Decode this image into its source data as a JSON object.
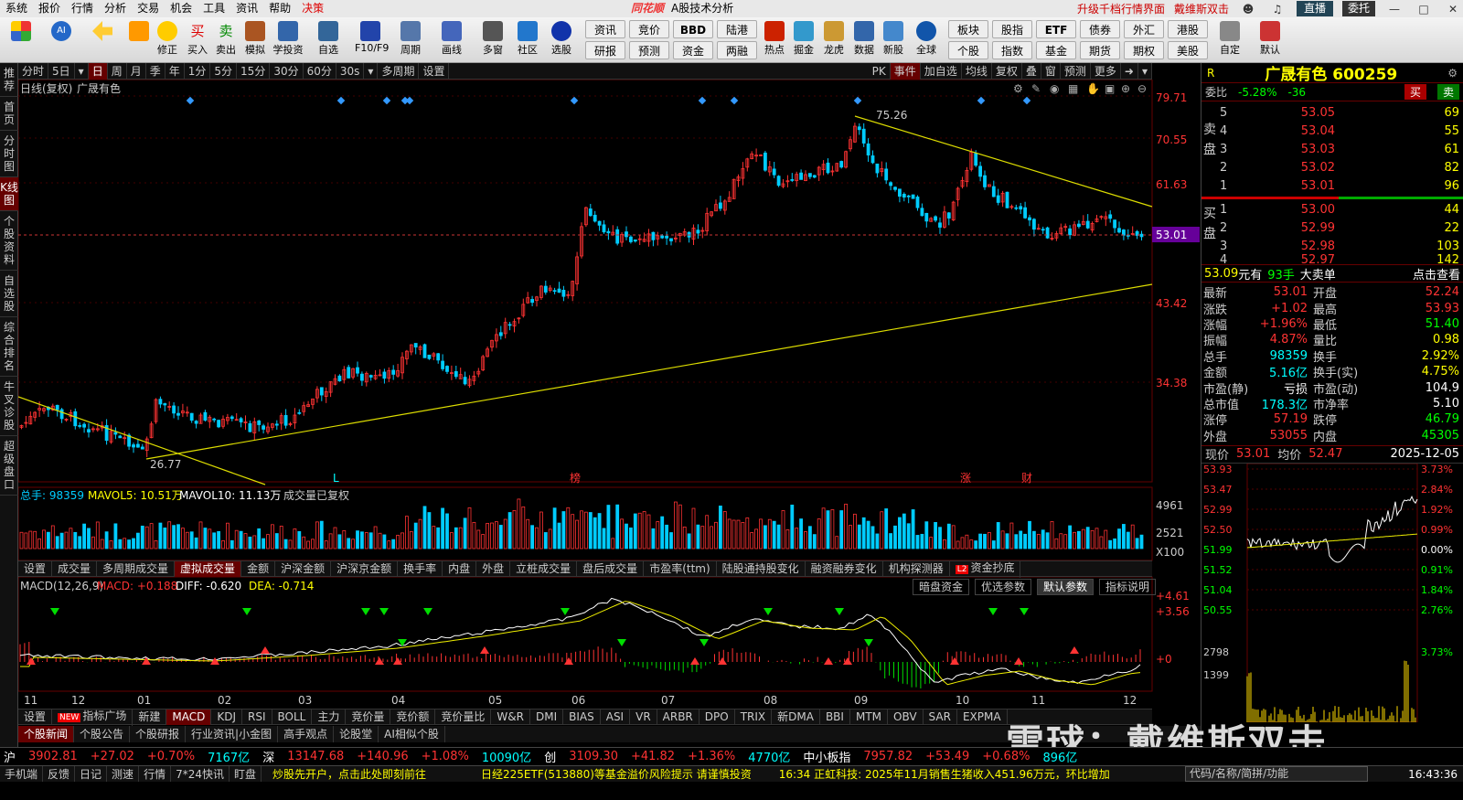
{
  "menu": {
    "items": [
      "系统",
      "报价",
      "行情",
      "分析",
      "交易",
      "机会",
      "工具",
      "资讯",
      "帮助",
      "决策"
    ],
    "brand": "同花顺",
    "subtitle": "A股技术分析",
    "upgrade": "升级千档行情界面",
    "dwsst": "戴维斯双击",
    "zhibo": "直播",
    "weituo": "委托"
  },
  "toolbar": {
    "buttons": [
      "修正",
      "买入",
      "卖出",
      "模拟",
      "学投资",
      "自选",
      "F10/F9",
      "周期",
      "画线",
      "多窗",
      "社区",
      "选股",
      "热点",
      "掘金",
      "龙虎",
      "数据",
      "新股",
      "全球",
      "自定",
      "默认"
    ],
    "grid": [
      [
        "资讯",
        "竞价",
        "BBD",
        "陆港"
      ],
      [
        "研报",
        "预测",
        "资金",
        "两融"
      ]
    ],
    "grid2": [
      [
        "板块",
        "股指",
        "ETF",
        "债券",
        "外汇",
        "港股"
      ],
      [
        "个股",
        "指数",
        "基金",
        "期货",
        "期权",
        "美股"
      ]
    ]
  },
  "sidebar": [
    "推荐",
    "首页",
    "分时图",
    "K线图",
    "个股资料",
    "自选股",
    "综合排名",
    "牛叉诊股",
    "超级盘口"
  ],
  "period": {
    "items": [
      "分时",
      "5日",
      "日",
      "周",
      "月",
      "季",
      "年",
      "1分",
      "5分",
      "15分",
      "30分",
      "60分",
      "30s",
      "多周期",
      "设置"
    ],
    "right": [
      "PK",
      "事件",
      "加自选",
      "均线",
      "复权",
      "叠",
      "窗",
      "预测",
      "更多"
    ]
  },
  "kline": {
    "label": "日线(复权)",
    "name": "广晟有色",
    "price_labels": [
      "79.71",
      "70.55",
      "61.63",
      "53.01",
      "43.42",
      "34.38"
    ],
    "high_label": "75.26",
    "low_label": "26.77",
    "markers": [
      "L",
      "榜",
      "涨",
      "财"
    ]
  },
  "volume": {
    "title": "总手: 98359",
    "mavol5": "MAVOL5: 10.51万",
    "mavol10": "MAVOL10: 11.13万",
    "note": "成交量已复权",
    "labels": [
      "4961",
      "2521",
      "X100"
    ]
  },
  "voltabs": [
    "设置",
    "成交量",
    "多周期成交量",
    "虚拟成交量",
    "金额",
    "沪深金额",
    "沪深京金额",
    "换手率",
    "内盘",
    "外盘",
    "立桩成交量",
    "盘后成交量",
    "市盈率(ttm)",
    "陆股通持股变化",
    "融资融券变化",
    "机构探测器",
    "资金抄底"
  ],
  "macd": {
    "title": "MACD(12,26,9)",
    "macd": "MACD: +0.188",
    "diff": "DIFF: -0.620",
    "dea": "DEA: -0.714",
    "labels": [
      "+4.61",
      "+3.56",
      "+0"
    ],
    "buttons": [
      "暗盘资金",
      "优选参数",
      "默认参数",
      "指标说明"
    ]
  },
  "xaxis": [
    "11",
    "12",
    "01",
    "02",
    "03",
    "04",
    "05",
    "06",
    "07",
    "08",
    "09",
    "10",
    "11",
    "12"
  ],
  "indtabs": [
    "设置",
    "指标广场",
    "新建",
    "MACD",
    "KDJ",
    "RSI",
    "BOLL",
    "主力",
    "竞价量",
    "竞价额",
    "竞价量比",
    "W&R",
    "DMI",
    "BIAS",
    "ASI",
    "VR",
    "ARBR",
    "DPO",
    "TRIX",
    "新DMA",
    "BBI",
    "MTM",
    "OBV",
    "SAR",
    "EXPMA"
  ],
  "newstabs": [
    "个股新闻",
    "个股公告",
    "个股研报",
    "行业资讯|小金图",
    "高手观点",
    "论股堂",
    "AI相似个股"
  ],
  "stock": {
    "code_flag": "R",
    "name": "广晟有色 600259",
    "weibi_label": "委比",
    "weibi": "-5.28%",
    "weicha": "-36",
    "buy": "买",
    "sell": "卖",
    "asks": [
      [
        "5",
        "53.05",
        "69"
      ],
      [
        "4",
        "53.04",
        "55"
      ],
      [
        "3",
        "53.03",
        "61"
      ],
      [
        "2",
        "53.02",
        "82"
      ],
      [
        "1",
        "53.01",
        "96"
      ]
    ],
    "bids": [
      [
        "1",
        "53.00",
        "44"
      ],
      [
        "2",
        "52.99",
        "22"
      ],
      [
        "3",
        "52.98",
        "103"
      ],
      [
        "4",
        "52.97",
        "142"
      ]
    ],
    "sell_label": "卖盘",
    "buy_label": "买盘",
    "bigorder": {
      "price": "53.09",
      "unit": "元有",
      "qty": "93手",
      "label": "大卖单",
      "link": "点击查看"
    },
    "stats": [
      [
        "最新",
        "53.01",
        "开盘",
        "52.24"
      ],
      [
        "涨跌",
        "+1.02",
        "最高",
        "53.93"
      ],
      [
        "涨幅",
        "+1.96%",
        "最低",
        "51.40"
      ],
      [
        "振幅",
        "4.87%",
        "量比",
        "0.98"
      ],
      [
        "总手",
        "98359",
        "换手",
        "2.92%"
      ],
      [
        "金额",
        "5.16亿",
        "换手(实)",
        "4.75%"
      ],
      [
        "市盈(静)",
        "亏损",
        "市盈(动)",
        "104.9"
      ],
      [
        "总市值",
        "178.3亿",
        "市净率",
        "5.10"
      ],
      [
        "涨停",
        "57.19",
        "跌停",
        "46.79"
      ],
      [
        "外盘",
        "53055",
        "内盘",
        "45305"
      ]
    ],
    "mini": {
      "xianjia": "现价",
      "xianjia_val": "53.01",
      "junjia": "均价",
      "junjia_val": "52.47",
      "date": "2025-12-05",
      "left": [
        "53.93",
        "53.47",
        "52.99",
        "52.50",
        "51.99",
        "51.52",
        "51.04",
        "50.55",
        "2798",
        "1399"
      ],
      "right": [
        "3.73%",
        "2.84%",
        "1.92%",
        "0.99%",
        "0.00%",
        "0.91%",
        "1.84%",
        "2.76%",
        "3.73%"
      ]
    }
  },
  "indexbar": {
    "sh": "沪",
    "sh_val": "3902.81",
    "sh_chg": "+27.02",
    "sh_pct": "+0.70%",
    "sh_amt": "7167亿",
    "sz": "深",
    "sz_val": "13147.68",
    "sz_chg": "+140.96",
    "sz_pct": "+1.08%",
    "sz_amt": "10090亿",
    "cy": "创",
    "cy_val": "3109.30",
    "cy_chg": "+41.82",
    "cy_pct": "+1.36%",
    "cy_amt": "4770亿",
    "zxb": "中小板指",
    "zxb_val": "7957.82",
    "zxb_chg": "+53.49",
    "zxb_pct": "+0.68%",
    "zxb_amt": "896亿"
  },
  "status": {
    "items": [
      "手机端",
      "反馈",
      "日记",
      "测速",
      "行情",
      "7*24快讯",
      "盯盘"
    ],
    "ticker1": "炒股先开户，点击此处即刻前往",
    "ticker2": "日经225ETF(513880)等基金溢价风险提示 请谨慎投资",
    "ticker3": "16:34 正虹科技: 2025年11月销售生猪收入451.96万元，环比增加",
    "search": "代码/名称/简拼/功能",
    "time": "16:43:36"
  },
  "watermark": "雪球：戴维斯双击"
}
